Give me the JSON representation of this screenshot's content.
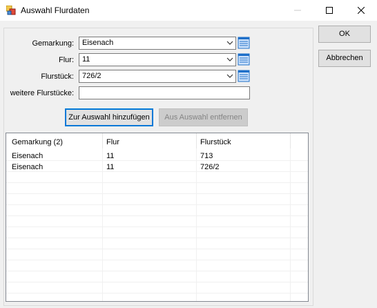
{
  "window": {
    "title": "Auswahl Flurdaten",
    "buttons": {
      "minimize": "minimize-icon",
      "maximize": "maximize-icon",
      "close": "close-icon"
    }
  },
  "form": {
    "gemarkung": {
      "label": "Gemarkung:",
      "value": "Eisenach"
    },
    "flur": {
      "label": "Flur:",
      "value": "11"
    },
    "flurstueck": {
      "label": "Flurstück:",
      "value": "726/2"
    },
    "weitere": {
      "label": "weitere Flurstücke:",
      "value": ""
    }
  },
  "actions": {
    "add": "Zur Auswahl hinzufügen",
    "remove": "Aus Auswahl entfernen"
  },
  "dialog_buttons": {
    "ok": "OK",
    "cancel": "Abbrechen"
  },
  "table": {
    "headers": [
      "Gemarkung (2)",
      "Flur",
      "Flurstück"
    ],
    "rows": [
      [
        "Eisenach",
        "11",
        "713"
      ],
      [
        "Eisenach",
        "11",
        "726/2"
      ]
    ]
  },
  "colors": {
    "focus_border": "#0078d7",
    "dialog_bg": "#f0f0f0",
    "icon_blue": "#1e6fc9"
  }
}
